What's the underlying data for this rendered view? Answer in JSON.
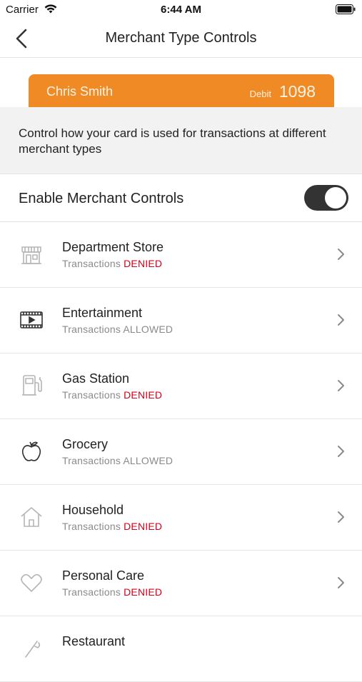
{
  "status_bar": {
    "carrier": "Carrier",
    "time": "6:44 AM"
  },
  "nav": {
    "title": "Merchant Type Controls"
  },
  "card": {
    "holder": "Chris Smith",
    "type": "Debit",
    "last4": "1098",
    "color": "#f08a24"
  },
  "description": "Control how your card is used for transactions at different merchant types",
  "enable_controls": {
    "label": "Enable Merchant Controls",
    "enabled": true
  },
  "merchants": [
    {
      "name": "Department Store",
      "status_prefix": "Transactions",
      "status": "DENIED",
      "icon": "storefront-icon"
    },
    {
      "name": "Entertainment",
      "status_prefix": "Transactions",
      "status": "ALLOWED",
      "icon": "film-icon"
    },
    {
      "name": "Gas Station",
      "status_prefix": "Transactions",
      "status": "DENIED",
      "icon": "fuel-pump-icon"
    },
    {
      "name": "Grocery",
      "status_prefix": "Transactions",
      "status": "ALLOWED",
      "icon": "apple-icon"
    },
    {
      "name": "Household",
      "status_prefix": "Transactions",
      "status": "DENIED",
      "icon": "house-icon"
    },
    {
      "name": "Personal Care",
      "status_prefix": "Transactions",
      "status": "DENIED",
      "icon": "heart-icon"
    },
    {
      "name": "Restaurant",
      "status_prefix": "",
      "status": "",
      "icon": "utensils-icon"
    }
  ],
  "colors": {
    "denied": "#d0021b",
    "allowed_text": "#8a8a8a",
    "toggle_on": "#333333"
  }
}
